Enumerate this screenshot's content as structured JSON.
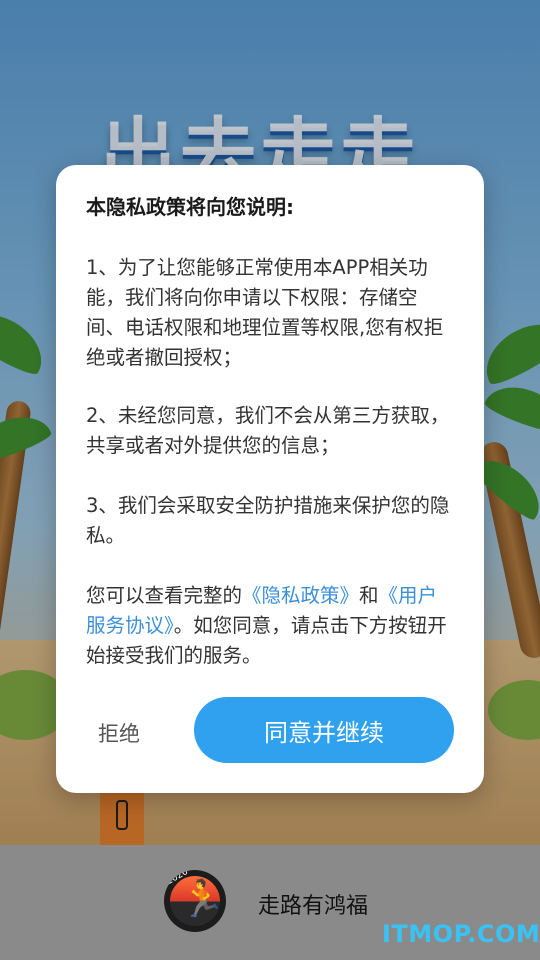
{
  "background": {
    "splash_title": "出去走走"
  },
  "dialog": {
    "title": "本隐私政策将向您说明:",
    "paragraph1": "1、为了让您能够正常使用本APP相关功能，我们将向你申请以下权限：存储空间、电话权限和地理位置等权限,您有权拒绝或者撤回授权；",
    "paragraph2": "2、未经您同意，我们不会从第三方获取，共享或者对外提供您的信息；",
    "paragraph3": "3、我们会采取安全防护措施来保护您的隐私。",
    "notice_prefix": "您可以查看完整的",
    "privacy_link": "《隐私政策》",
    "notice_and": "和",
    "terms_link": "《用户服务协议》",
    "notice_suffix": "。如您同意，请点击下方按钮开始接受我们的服务。",
    "refuse_label": "拒绝",
    "agree_label": "同意并继续",
    "link_color": "#3b8fd9",
    "agree_button_color": "#2fa1ef"
  },
  "app": {
    "logo_icon": "runner-logo-icon",
    "logo_year": "2026",
    "name": "走路有鸿福"
  },
  "watermark": "ITMOP.COM"
}
